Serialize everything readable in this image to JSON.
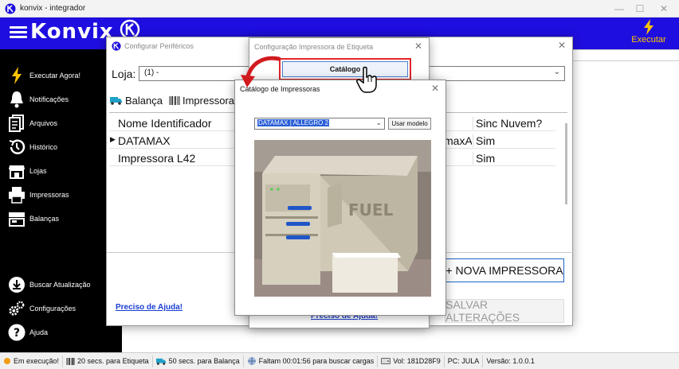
{
  "window": {
    "title": "konvix - integrador",
    "minimize": "—",
    "maximize": "☐",
    "close": "✕"
  },
  "header": {
    "brand": "Konvix",
    "execute_label": "Executar"
  },
  "sidebar": {
    "items": [
      {
        "label": "Executar Agora!",
        "icon": "lightning-icon"
      },
      {
        "label": "Notificações",
        "icon": "bell-icon"
      },
      {
        "label": "Arquivos",
        "icon": "files-icon"
      },
      {
        "label": "Histórico",
        "icon": "history-icon"
      },
      {
        "label": "Lojas",
        "icon": "store-icon"
      },
      {
        "label": "Impressoras",
        "icon": "printer-icon"
      },
      {
        "label": "Balanças",
        "icon": "scale-icon"
      },
      {
        "label": "Buscar Atualização",
        "icon": "download-icon"
      },
      {
        "label": "Configurações",
        "icon": "gears-icon"
      },
      {
        "label": "Ajuda",
        "icon": "help-icon"
      }
    ]
  },
  "perifericos": {
    "title": "Configurar Periféricos",
    "loja_label": "Loja:",
    "loja_value": "(1) - ",
    "tabs": [
      {
        "label": "Balança",
        "icon": "truck-icon"
      },
      {
        "label": "Impressoras",
        "icon": "barcode-icon"
      }
    ],
    "columns": {
      "name": "Nome Identificador",
      "sync": "Sinc Nuvem?"
    },
    "rows": [
      {
        "name": "DATAMAX",
        "model": "maxA",
        "sync": "Sim",
        "selected": true
      },
      {
        "name": "Impressora L42",
        "model": "",
        "sync": "Sim",
        "selected": false
      }
    ],
    "new_button": "+ NOVA IMPRESSORA",
    "save_button": "SALVAR ALTERAÇÕES",
    "help_link": "Preciso de Ajuda!"
  },
  "etiqueta": {
    "title": "Configuração Impressora de Etiqueta",
    "catalog_button": "Catálogo",
    "help_link": "Preciso de Ajuda!"
  },
  "catalogo": {
    "title": "Catálogo de Impressoras",
    "model_value": "DATAMAX | ALLEGRO 2",
    "use_button": "Usar modelo",
    "photo_brand_text": "FUEL"
  },
  "status": {
    "running": "Em execução!",
    "label_interval": "20 secs. para Etiqueta",
    "scale_interval": "50 secs. para Balança",
    "remaining": "Faltam 00:01:56 para buscar cargas",
    "volume": "Vol: 181D28F9",
    "pc": "PC: JULA",
    "version": "Versão: 1.0.0.1"
  },
  "colors": {
    "topbar": "#1f0ee0",
    "sidebar": "#000000",
    "accent": "#ffc400",
    "highlight": "#e2242a",
    "link": "#1a3fd4"
  }
}
